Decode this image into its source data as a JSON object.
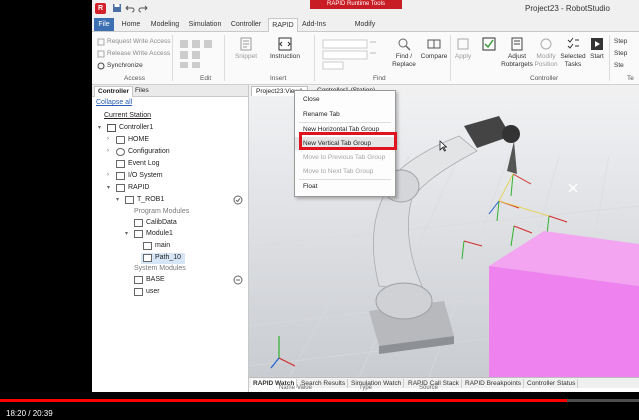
{
  "window": {
    "title": "Project23 - RobotStudio",
    "context_label": "RAPID Runtime Tools"
  },
  "tabs": [
    "File",
    "Home",
    "Modeling",
    "Simulation",
    "Controller",
    "RAPID",
    "Add-Ins",
    "Modify"
  ],
  "active_tab": "RAPID",
  "ribbon": {
    "access": {
      "items": [
        "Request Write Access",
        "Release Write Access",
        "Synchronize"
      ],
      "label": "Access"
    },
    "edit": {
      "label": "Edit"
    },
    "insert": {
      "items": [
        "Snippet",
        "Instruction"
      ],
      "label": "Insert"
    },
    "find": {
      "items": [
        "Find / Replace",
        "Compare"
      ],
      "label": "Find"
    },
    "controller": {
      "items": [
        "Apply",
        "Check Program",
        "Adjust Robtargets",
        "Modify Position",
        "Selected Tasks",
        "Start"
      ],
      "label": "Controller"
    },
    "right": {
      "items": [
        "Step",
        "Step",
        "Ste"
      ],
      "label": "Te"
    }
  },
  "left_panel": {
    "tabs": [
      "Controller",
      "Files"
    ],
    "collapse_all": "Collapse all",
    "current_station": "Current Station",
    "tree": {
      "controller": "Controller1",
      "home": "HOME",
      "configuration": "Configuration",
      "event_log": "Event Log",
      "io_system": "I/O System",
      "rapid": "RAPID",
      "task": "T_ROB1",
      "program_modules": "Program Modules",
      "calibdata": "CalibData",
      "module1": "Module1",
      "main": "main",
      "path": "Path_10",
      "system_modules": "System Modules",
      "base": "BASE",
      "user": "user"
    }
  },
  "viewport": {
    "tabs": [
      "Project23:View1",
      "Controller1 (Station)"
    ]
  },
  "context_menu": {
    "items": [
      {
        "label": "Close",
        "enabled": true
      },
      {
        "label": "Rename Tab",
        "enabled": true
      },
      {
        "label": "New Horizontal Tab Group",
        "enabled": true
      },
      {
        "label": "New Vertical Tab Group",
        "enabled": true
      },
      {
        "label": "Move to Previous Tab Group",
        "enabled": false
      },
      {
        "label": "Move to Next Tab Group",
        "enabled": false
      },
      {
        "label": "Float",
        "enabled": true
      }
    ],
    "hovered": "New Vertical Tab Group"
  },
  "bottom_panel": {
    "tabs": [
      "RAPID Watch",
      "Search Results",
      "Simulation Watch",
      "RAPID Call Stack",
      "RAPID Breakpoints",
      "Controller Status"
    ],
    "columns": [
      "Name",
      "Value",
      "Type",
      "Source"
    ]
  },
  "video": {
    "time": "18:20 / 20:39",
    "progress": 0.888,
    "progress_color": "#ff0000"
  },
  "colors": {
    "accent": "#3d70b2",
    "highlight_box": "#e0141e",
    "box_magenta": "#ee82ee"
  }
}
